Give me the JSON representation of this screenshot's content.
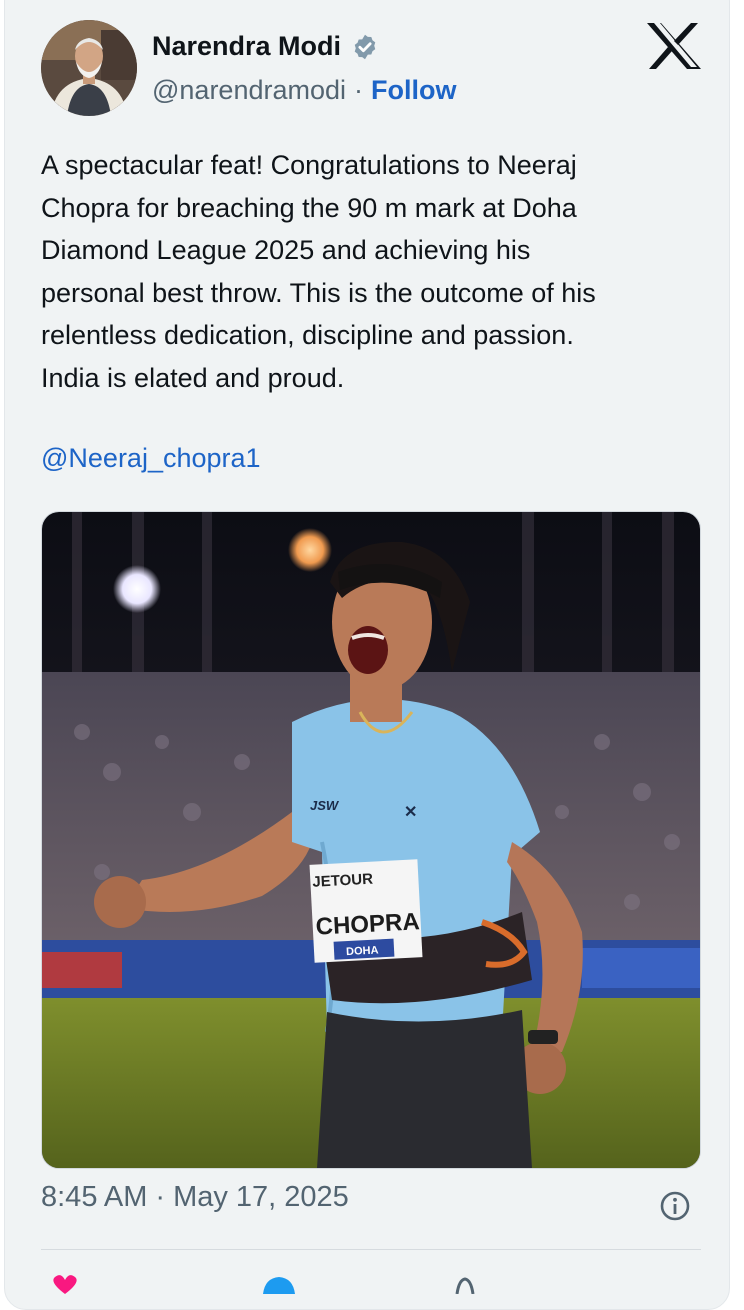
{
  "author": {
    "display_name": "Narendra Modi",
    "handle": "@narendramodi",
    "separator": "·",
    "follow_label": "Follow"
  },
  "tweet": {
    "text": "A spectacular feat! Congratulations to Neeraj\nChopra for breaching the 90 m mark at Doha\nDiamond League 2025 and achieving his\npersonal best throw. This is the outcome of his\nrelentless dedication, discipline and passion.\nIndia is elated and proud.",
    "mention": "@Neeraj_chopra1"
  },
  "media": {
    "bib_sponsor": "JETOUR",
    "bib_name": "CHOPRA",
    "bib_event": "DOHA",
    "shirt_logo": "JSW"
  },
  "meta": {
    "time": "8:45 AM",
    "separator": "·",
    "date": "May 17, 2025"
  },
  "icons": {
    "verified": "verified-badge-icon",
    "platform": "x-logo-icon",
    "info": "info-icon",
    "like": "heart-icon",
    "reply": "reply-icon",
    "share": "share-icon"
  },
  "colors": {
    "link": "#1d64c7",
    "text": "#0f1419",
    "secondary": "#536471",
    "card_bg": "#f0f3f4",
    "like": "#f91880"
  }
}
